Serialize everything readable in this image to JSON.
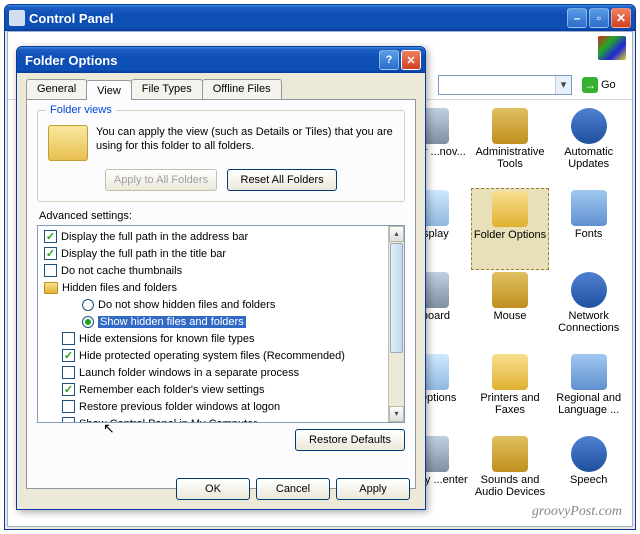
{
  "main_window": {
    "title": "Control Panel"
  },
  "address_bar": {
    "go": "Go"
  },
  "cp_items": [
    [
      {
        "label": "...ld or\n...nov..."
      },
      {
        "label": "Administrative Tools"
      },
      {
        "label": "Automatic Updates"
      }
    ],
    [
      {
        "label": "...splay"
      },
      {
        "label": "Folder Options",
        "selected": true
      },
      {
        "label": "Fonts"
      }
    ],
    [
      {
        "label": "...board"
      },
      {
        "label": "Mouse"
      },
      {
        "label": "Network Connections"
      }
    ],
    [
      {
        "label": "... Options"
      },
      {
        "label": "Printers and Faxes"
      },
      {
        "label": "Regional and Language ..."
      }
    ],
    [
      {
        "label": "...curity\n...enter"
      },
      {
        "label": "Sounds and Audio Devices"
      },
      {
        "label": "Speech"
      }
    ]
  ],
  "dialog": {
    "title": "Folder Options",
    "tabs": [
      "General",
      "View",
      "File Types",
      "Offline Files"
    ],
    "active_tab": 1,
    "folder_views": {
      "legend": "Folder views",
      "text": "You can apply the view (such as Details or Tiles) that you are using for this folder to all folders.",
      "apply_btn": "Apply to All Folders",
      "reset_btn": "Reset All Folders"
    },
    "advanced_label": "Advanced settings:",
    "tree": [
      {
        "type": "check",
        "checked": true,
        "indent": 0,
        "label": "Display the full path in the address bar"
      },
      {
        "type": "check",
        "checked": true,
        "indent": 0,
        "label": "Display the full path in the title bar"
      },
      {
        "type": "check",
        "checked": false,
        "indent": 0,
        "label": "Do not cache thumbnails"
      },
      {
        "type": "folder",
        "indent": 0,
        "label": "Hidden files and folders"
      },
      {
        "type": "radio",
        "checked": false,
        "indent": 2,
        "label": "Do not show hidden files and folders"
      },
      {
        "type": "radio",
        "checked": true,
        "indent": 2,
        "label": "Show hidden files and folders",
        "selected": true
      },
      {
        "type": "check",
        "checked": false,
        "indent": 1,
        "label": "Hide extensions for known file types"
      },
      {
        "type": "check",
        "checked": true,
        "indent": 1,
        "label": "Hide protected operating system files (Recommended)"
      },
      {
        "type": "check",
        "checked": false,
        "indent": 1,
        "label": "Launch folder windows in a separate process"
      },
      {
        "type": "check",
        "checked": true,
        "indent": 1,
        "label": "Remember each folder's view settings"
      },
      {
        "type": "check",
        "checked": false,
        "indent": 1,
        "label": "Restore previous folder windows at logon"
      },
      {
        "type": "check",
        "checked": false,
        "indent": 1,
        "label": "Show Control Panel in My Computer"
      }
    ],
    "restore_btn": "Restore Defaults",
    "ok": "OK",
    "cancel": "Cancel",
    "apply": "Apply"
  },
  "watermark": "groovyPost.com"
}
